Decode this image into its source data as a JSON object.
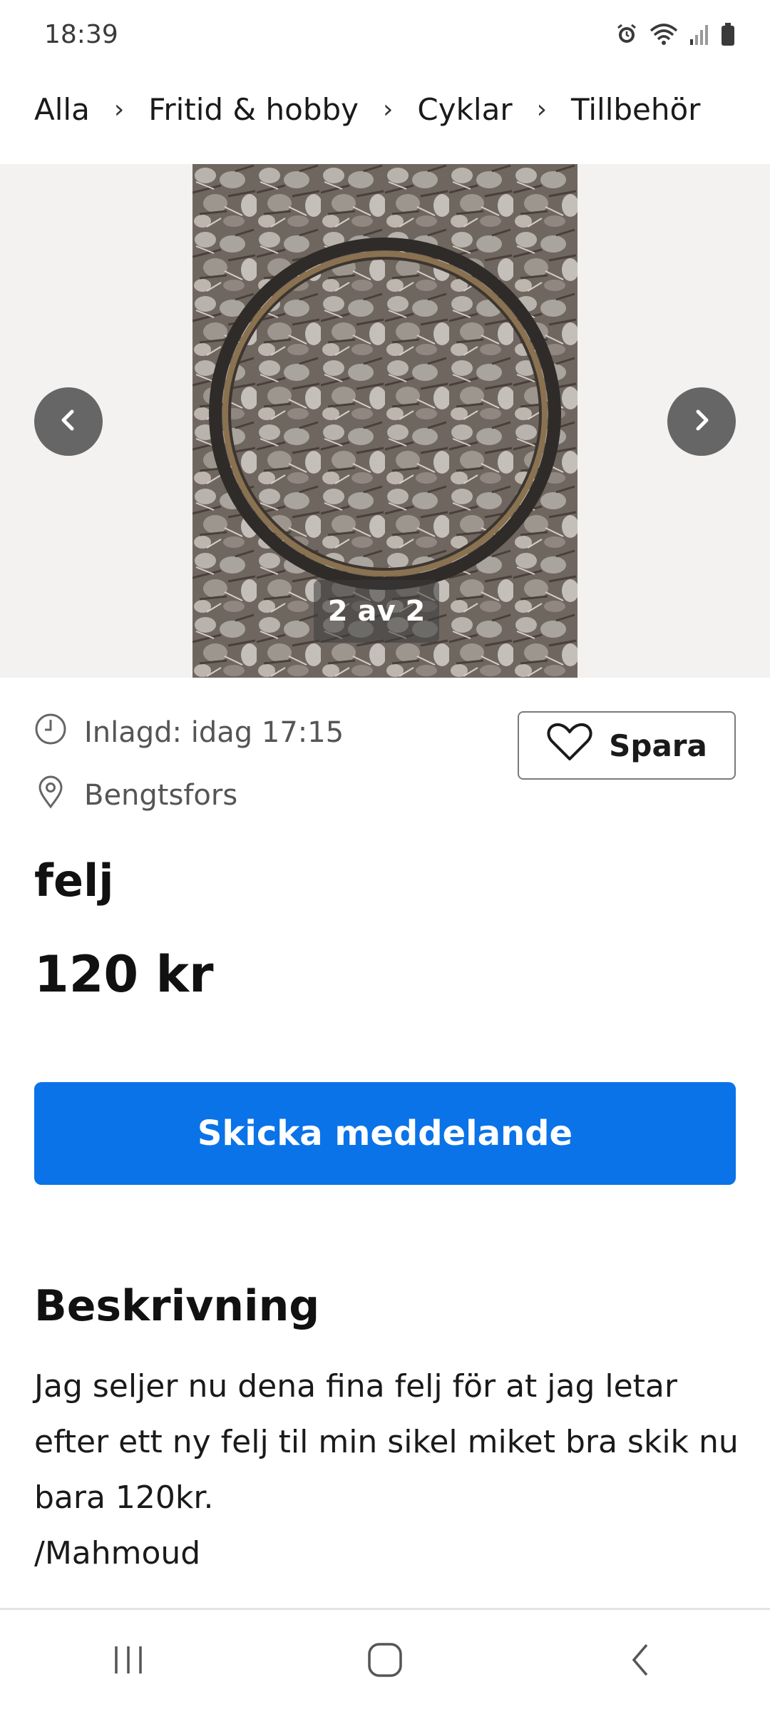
{
  "status_bar": {
    "time": "18:39",
    "icons": [
      "alarm-icon",
      "wifi-icon",
      "signal-icon",
      "battery-icon"
    ]
  },
  "breadcrumb": {
    "items": [
      "Alla",
      "Fritid & hobby",
      "Cyklar",
      "Tillbehör"
    ],
    "separator": "›"
  },
  "gallery": {
    "counter": "2 av 2",
    "prev_icon": "chevron-left-icon",
    "next_icon": "chevron-right-icon"
  },
  "listing": {
    "posted": "Inlagd: idag 17:15",
    "location": "Bengtsfors",
    "save_label": "Spara",
    "title": "felj",
    "price": "120 kr"
  },
  "actions": {
    "message_label": "Skicka meddelande"
  },
  "description": {
    "heading": "Beskrivning",
    "lines": [
      "Jag seljer nu dena fina felj för at jag letar",
      "efter ett ny felj til min sikel miket bra skik nu",
      "bara 120kr.",
      "/Mahmoud"
    ]
  },
  "bottom_nav": {
    "icons": [
      "recent-apps-icon",
      "home-icon",
      "back-icon"
    ]
  },
  "colors": {
    "accent": "#0a73e8",
    "gallery_bg": "#f3f2f0",
    "nav_button": "#666666"
  }
}
